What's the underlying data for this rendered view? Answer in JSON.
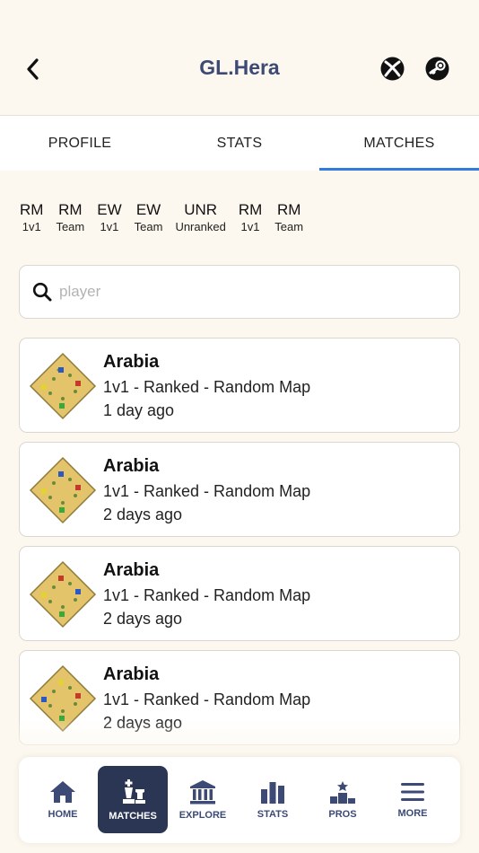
{
  "header": {
    "title": "GL.Hera",
    "back_icon": "chevron-left-icon",
    "xbox_icon": "xbox-icon",
    "steam_icon": "steam-icon",
    "accent": "#3c4a75"
  },
  "tabs": [
    {
      "label": "PROFILE",
      "active": false
    },
    {
      "label": "STATS",
      "active": false
    },
    {
      "label": "MATCHES",
      "active": true
    }
  ],
  "filters": [
    {
      "top": "RM",
      "bottom": "1v1"
    },
    {
      "top": "RM",
      "bottom": "Team"
    },
    {
      "top": "EW",
      "bottom": "1v1"
    },
    {
      "top": "EW",
      "bottom": "Team"
    },
    {
      "top": "UNR",
      "bottom": "Unranked"
    },
    {
      "top": "RM",
      "bottom": "1v1"
    },
    {
      "top": "RM",
      "bottom": "Team"
    }
  ],
  "search": {
    "placeholder": "player",
    "value": ""
  },
  "matches": [
    {
      "map": "Arabia",
      "mode": "1v1 - Ranked - Random Map",
      "time": "1 day ago"
    },
    {
      "map": "Arabia",
      "mode": "1v1 - Ranked - Random Map",
      "time": "2 days ago"
    },
    {
      "map": "Arabia",
      "mode": "1v1 - Ranked - Random Map",
      "time": "2 days ago"
    },
    {
      "map": "Arabia",
      "mode": "1v1 - Ranked - Random Map",
      "time": "2 days ago"
    }
  ],
  "nav": [
    {
      "label": "HOME",
      "icon": "home-icon",
      "active": false
    },
    {
      "label": "MATCHES",
      "icon": "chess-icon",
      "active": true
    },
    {
      "label": "EXPLORE",
      "icon": "building-icon",
      "active": false
    },
    {
      "label": "STATS",
      "icon": "bar-chart-icon",
      "active": false
    },
    {
      "label": "PROS",
      "icon": "podium-icon",
      "active": false
    },
    {
      "label": "MORE",
      "icon": "menu-icon",
      "active": false
    }
  ],
  "colors": {
    "tab_indicator": "#2f7be0",
    "nav_active_bg": "#2b3554",
    "background": "#fdf8ef"
  }
}
